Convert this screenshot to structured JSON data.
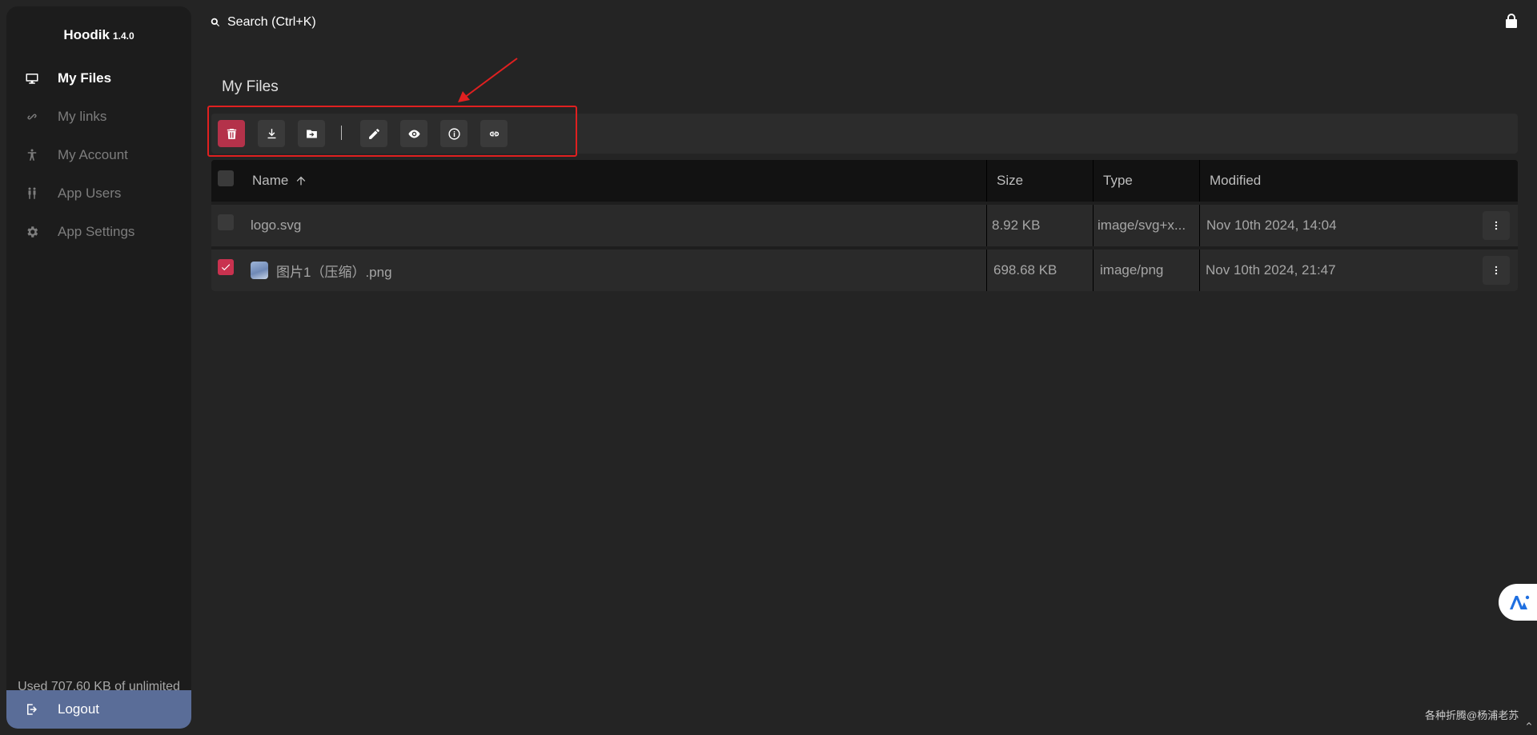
{
  "app": {
    "name": "Hoodik",
    "version": "1.4.0"
  },
  "sidebar": {
    "items": [
      {
        "label": "My Files",
        "icon": "monitor-icon",
        "active": true
      },
      {
        "label": "My links",
        "icon": "link-icon",
        "active": false
      },
      {
        "label": "My Account",
        "icon": "person-icon",
        "active": false
      },
      {
        "label": "App Users",
        "icon": "users-icon",
        "active": false
      },
      {
        "label": "App Settings",
        "icon": "gear-icon",
        "active": false
      }
    ],
    "usage": "Used 707.60 KB of unlimited",
    "logout_label": "Logout"
  },
  "header": {
    "search_label": "Search (Ctrl+K)"
  },
  "main": {
    "title": "My Files",
    "toolbar": [
      {
        "action": "delete",
        "icon": "trash-icon"
      },
      {
        "action": "download",
        "icon": "download-icon"
      },
      {
        "action": "move",
        "icon": "folder-move-icon"
      },
      {
        "action": "rename",
        "icon": "pencil-icon"
      },
      {
        "action": "preview",
        "icon": "eye-icon"
      },
      {
        "action": "details",
        "icon": "info-icon"
      },
      {
        "action": "share-link",
        "icon": "link-icon"
      }
    ],
    "table": {
      "columns": [
        "Name",
        "Size",
        "Type",
        "Modified"
      ],
      "sort": {
        "column": "Name",
        "direction": "asc"
      },
      "rows": [
        {
          "name": "logo.svg",
          "size": "8.92 KB",
          "type": "image/svg+x...",
          "modified": "Nov 10th 2024, 14:04",
          "selected": false,
          "thumbnail": false
        },
        {
          "name": "图片1（压缩）.png",
          "size": "698.68 KB",
          "type": "image/png",
          "modified": "Nov 10th 2024, 21:47",
          "selected": true,
          "thumbnail": true
        }
      ]
    }
  },
  "watermark": "各种折腾@杨浦老苏",
  "colors": {
    "background": "#242424",
    "sidebar": "#1c1c1c",
    "accent_danger": "#b4324a",
    "logout": "#5a6d98",
    "highlight_annotation": "#e02020"
  }
}
